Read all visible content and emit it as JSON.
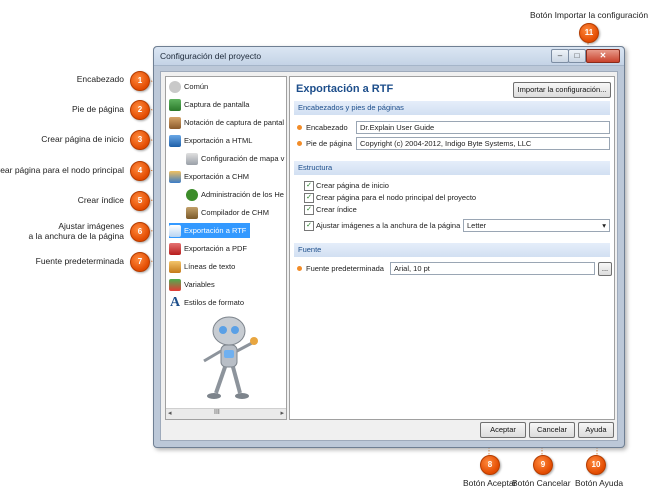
{
  "callouts": {
    "top": "Botón Importar la configuración",
    "left": [
      {
        "num": "1",
        "text": "Encabezado"
      },
      {
        "num": "2",
        "text": "Pie de página"
      },
      {
        "num": "3",
        "text": "Crear página de inicio"
      },
      {
        "num": "4",
        "text": "Crear página para el nodo principal"
      },
      {
        "num": "5",
        "text": "Crear índice"
      },
      {
        "num": "6",
        "line1": "Ajustar imágenes",
        "line2": "a la anchura de la página"
      },
      {
        "num": "7",
        "text": "Fuente predeterminada"
      }
    ],
    "num11": "11",
    "bottom": [
      {
        "num": "8",
        "text": "Botón Aceptar"
      },
      {
        "num": "9",
        "text": "Botón Cancelar"
      },
      {
        "num": "10",
        "text": "Botón Ayuda"
      }
    ]
  },
  "window": {
    "title": "Configuración del proyecto",
    "min": "–",
    "max": "□",
    "close": "✕"
  },
  "nav": [
    {
      "label": "Común",
      "icon": "common-icon"
    },
    {
      "label": "Captura de pantalla",
      "icon": "screenshot-icon"
    },
    {
      "label": "Notación de captura de pantal",
      "icon": "annotation-icon"
    },
    {
      "label": "Exportación a HTML",
      "icon": "html-export-icon"
    },
    {
      "label": "Configuración de mapa v",
      "icon": "map-config-icon"
    },
    {
      "label": "Exportación a CHM",
      "icon": "chm-export-icon"
    },
    {
      "label": "Administración de los He",
      "icon": "id-icon"
    },
    {
      "label": "Compilador de CHM",
      "icon": "chm-compiler-icon"
    },
    {
      "label": "Exportación a RTF",
      "icon": "rtf-export-icon"
    },
    {
      "label": "Exportación a PDF",
      "icon": "pdf-export-icon"
    },
    {
      "label": "Líneas de texto",
      "icon": "text-lines-icon"
    },
    {
      "label": "Variables",
      "icon": "variables-icon"
    },
    {
      "label": "Estilos de formato",
      "icon": "format-styles-icon"
    }
  ],
  "scroll_mark": "III",
  "main": {
    "title": "Exportación a RTF",
    "import_button": "Importar la configuración...",
    "section_headers": "Encabezados y pies de páginas",
    "header_label": "Encabezado",
    "header_value": "Dr.Explain User Guide",
    "footer_label": "Pie de página",
    "footer_value": "Copyright (c) 2004-2012, Indigo Byte Systems, LLC",
    "section_structure": "Estructura",
    "cb1": "Crear página de inicio",
    "cb2": "Crear página para el nodo principal del proyecto",
    "cb3": "Crear índice",
    "cb4": "Ajustar imágenes a la anchura de la página",
    "paper_value": "Letter",
    "section_font": "Fuente",
    "font_label": "Fuente predeterminada",
    "font_value": "Arial, 10 pt",
    "font_button": "...",
    "check": "✓",
    "dropdown_arrow": "▾"
  },
  "buttons": {
    "ok": "Aceptar",
    "cancel": "Cancelar",
    "help": "Ayuda"
  },
  "colors": {
    "accent": "#1d4e8b",
    "badge": "#e24a00",
    "selection": "#3399ff",
    "callout_line": "#e07020"
  }
}
